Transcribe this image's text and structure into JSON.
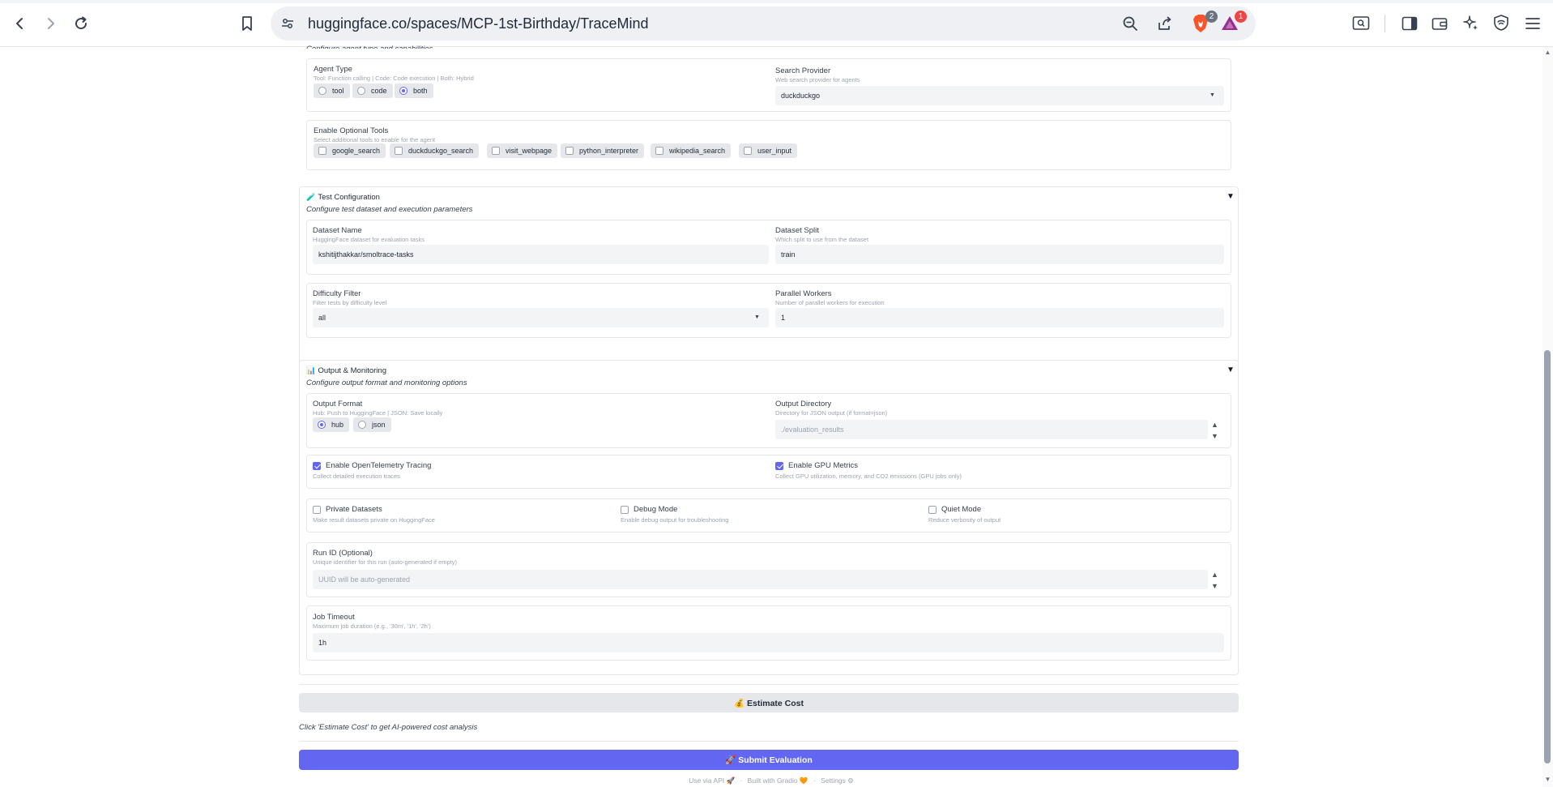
{
  "browser": {
    "url": "huggingface.co/spaces/MCP-1st-Birthday/TraceMind",
    "brave_badge": "2",
    "rewards_badge": "1"
  },
  "agent_section": {
    "clipped_desc": "Configure agent type and capabilities",
    "agent_type": {
      "label": "Agent Type",
      "info": "Tool: Function calling | Code: Code execution | Both: Hybrid",
      "options": [
        "tool",
        "code",
        "both"
      ],
      "selected": "both"
    },
    "search_provider": {
      "label": "Search Provider",
      "info": "Web search provider for agents",
      "value": "duckduckgo"
    },
    "optional_tools": {
      "label": "Enable Optional Tools",
      "info": "Select additional tools to enable for the agent",
      "options": [
        "google_search",
        "duckduckgo_search",
        "visit_webpage",
        "python_interpreter",
        "wikipedia_search",
        "user_input"
      ]
    }
  },
  "test_section": {
    "icon": "🧪",
    "title": "Test Configuration",
    "desc": "Configure test dataset and execution parameters",
    "dataset_name": {
      "label": "Dataset Name",
      "info": "HuggingFace dataset for evaluation tasks",
      "value": "kshitijthakkar/smoltrace-tasks"
    },
    "dataset_split": {
      "label": "Dataset Split",
      "info": "Which split to use from the dataset",
      "value": "train"
    },
    "difficulty": {
      "label": "Difficulty Filter",
      "info": "Filter tests by difficulty level",
      "value": "all"
    },
    "workers": {
      "label": "Parallel Workers",
      "info": "Number of parallel workers for execution",
      "value": "1"
    }
  },
  "output_section": {
    "icon": "📊",
    "title": "Output & Monitoring",
    "desc": "Configure output format and monitoring options",
    "output_format": {
      "label": "Output Format",
      "info": "Hub: Push to HuggingFace | JSON: Save locally",
      "options": [
        "hub",
        "json"
      ],
      "selected": "hub"
    },
    "output_dir": {
      "label": "Output Directory",
      "info": "Directory for JSON output (if format=json)",
      "placeholder": "./evaluation_results"
    },
    "otel": {
      "label": "Enable OpenTelemetry Tracing",
      "info": "Collect detailed execution traces",
      "checked": true
    },
    "gpu": {
      "label": "Enable GPU Metrics",
      "info": "Collect GPU utilization, memory, and CO2 emissions (GPU jobs only)",
      "checked": true
    },
    "private": {
      "label": "Private Datasets",
      "info": "Make result datasets private on HuggingFace",
      "checked": false
    },
    "debug": {
      "label": "Debug Mode",
      "info": "Enable debug output for troubleshooting",
      "checked": false
    },
    "quiet": {
      "label": "Quiet Mode",
      "info": "Reduce verbosity of output",
      "checked": false
    },
    "run_id": {
      "label": "Run ID (Optional)",
      "info": "Unique identifier for this run (auto-generated if empty)",
      "placeholder": "UUID will be auto-generated"
    },
    "timeout": {
      "label": "Job Timeout",
      "info": "Maximum job duration (e.g., '30m', '1h', '2h')",
      "value": "1h"
    }
  },
  "actions": {
    "estimate_label": "💰 Estimate Cost",
    "estimate_hint": "Click 'Estimate Cost' to get AI-powered cost analysis",
    "submit_label": "🚀 Submit Evaluation"
  },
  "footer": {
    "api": "Use via API 🚀",
    "built": "Built with Gradio 🧡",
    "settings": "Settings ⚙"
  }
}
